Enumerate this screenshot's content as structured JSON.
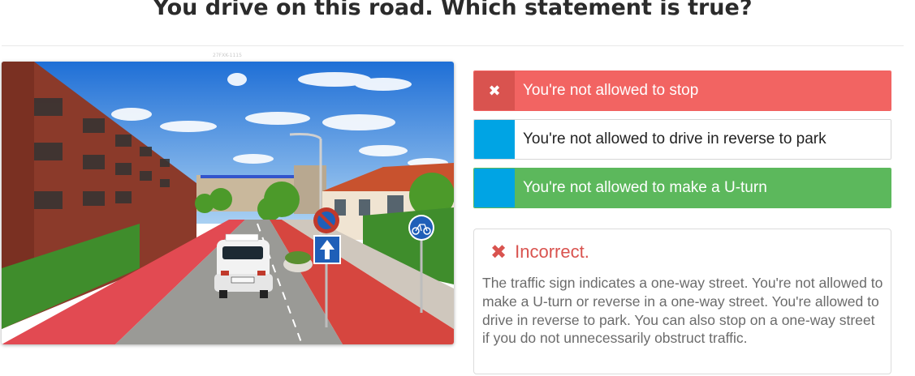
{
  "question": {
    "title": "You drive on this road. Which statement is true?"
  },
  "image": {
    "caption": "27FXK-1115"
  },
  "answers": [
    {
      "marker": "✖",
      "label": "You're not allowed to stop",
      "state": "selected-wrong"
    },
    {
      "marker": "",
      "label": "You're not allowed to drive in reverse to park",
      "state": "neutral"
    },
    {
      "marker": "",
      "label": "You're not allowed to make a U-turn",
      "state": "correct"
    }
  ],
  "feedback": {
    "icon": "✖",
    "verdict": "Incorrect.",
    "explanation": "The traffic sign indicates a one-way street. You're not allowed to make a U-turn or reverse in a one-way street. You're allowed to drive in reverse to park. You can also stop on a one-way street if you do not unnecessarily obstruct traffic."
  },
  "colors": {
    "wrong": "#f26462",
    "correct": "#5cb85c",
    "marker": "#00a4e4",
    "verdict": "#d9534f"
  }
}
